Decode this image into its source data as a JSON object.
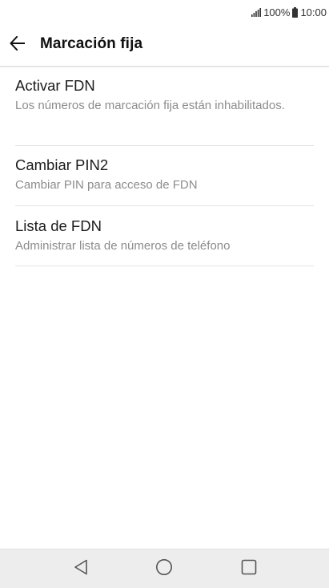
{
  "status_bar": {
    "battery_percent": "100%",
    "time": "10:00",
    "signal_icon": "signal-bars-icon",
    "battery_icon": "battery-full-icon"
  },
  "app_bar": {
    "back_icon": "arrow-left-icon",
    "title": "Marcación fija"
  },
  "settings": [
    {
      "title": "Activar FDN",
      "summary": "Los números de marcación fija están inhabilitados."
    },
    {
      "title": "Cambiar PIN2",
      "summary": "Cambiar PIN para acceso de FDN"
    },
    {
      "title": "Lista de FDN",
      "summary": "Administrar lista de números de teléfono"
    }
  ],
  "nav_bar": {
    "back_icon": "triangle-back-icon",
    "home_icon": "circle-home-icon",
    "recents_icon": "square-recents-icon"
  },
  "colors": {
    "background": "#ffffff",
    "nav_bar": "#ededed",
    "title_text": "#111111",
    "summary_text": "#8c8c8c",
    "divider": "#e3e3e3"
  }
}
